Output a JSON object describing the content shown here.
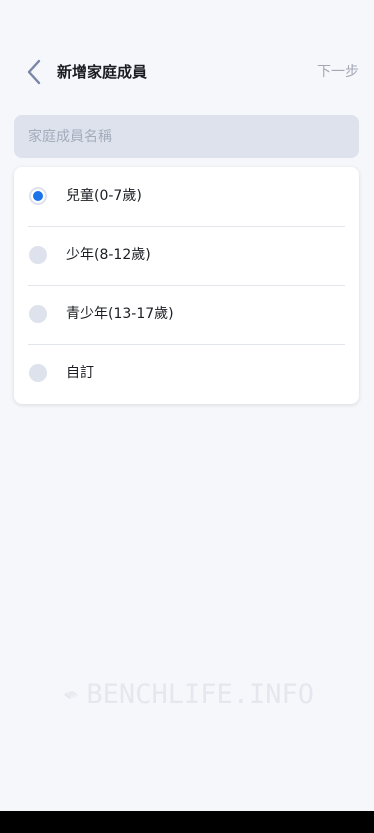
{
  "header": {
    "title": "新增家庭成員",
    "next_label": "下一步"
  },
  "name_field": {
    "placeholder": "家庭成員名稱",
    "value": ""
  },
  "age_options": [
    {
      "label": "兒童(0-7歲)",
      "selected": true
    },
    {
      "label": "少年(8-12歲)",
      "selected": false
    },
    {
      "label": "青少年(13-17歲)",
      "selected": false
    },
    {
      "label": "自訂",
      "selected": false
    }
  ],
  "colors": {
    "background": "#f6f7fb",
    "accent": "#1a73e8",
    "input_bg": "#dde2ec",
    "muted_text": "#a3a8b4"
  },
  "watermark": {
    "text": "BENCHLIFE.INFO"
  }
}
